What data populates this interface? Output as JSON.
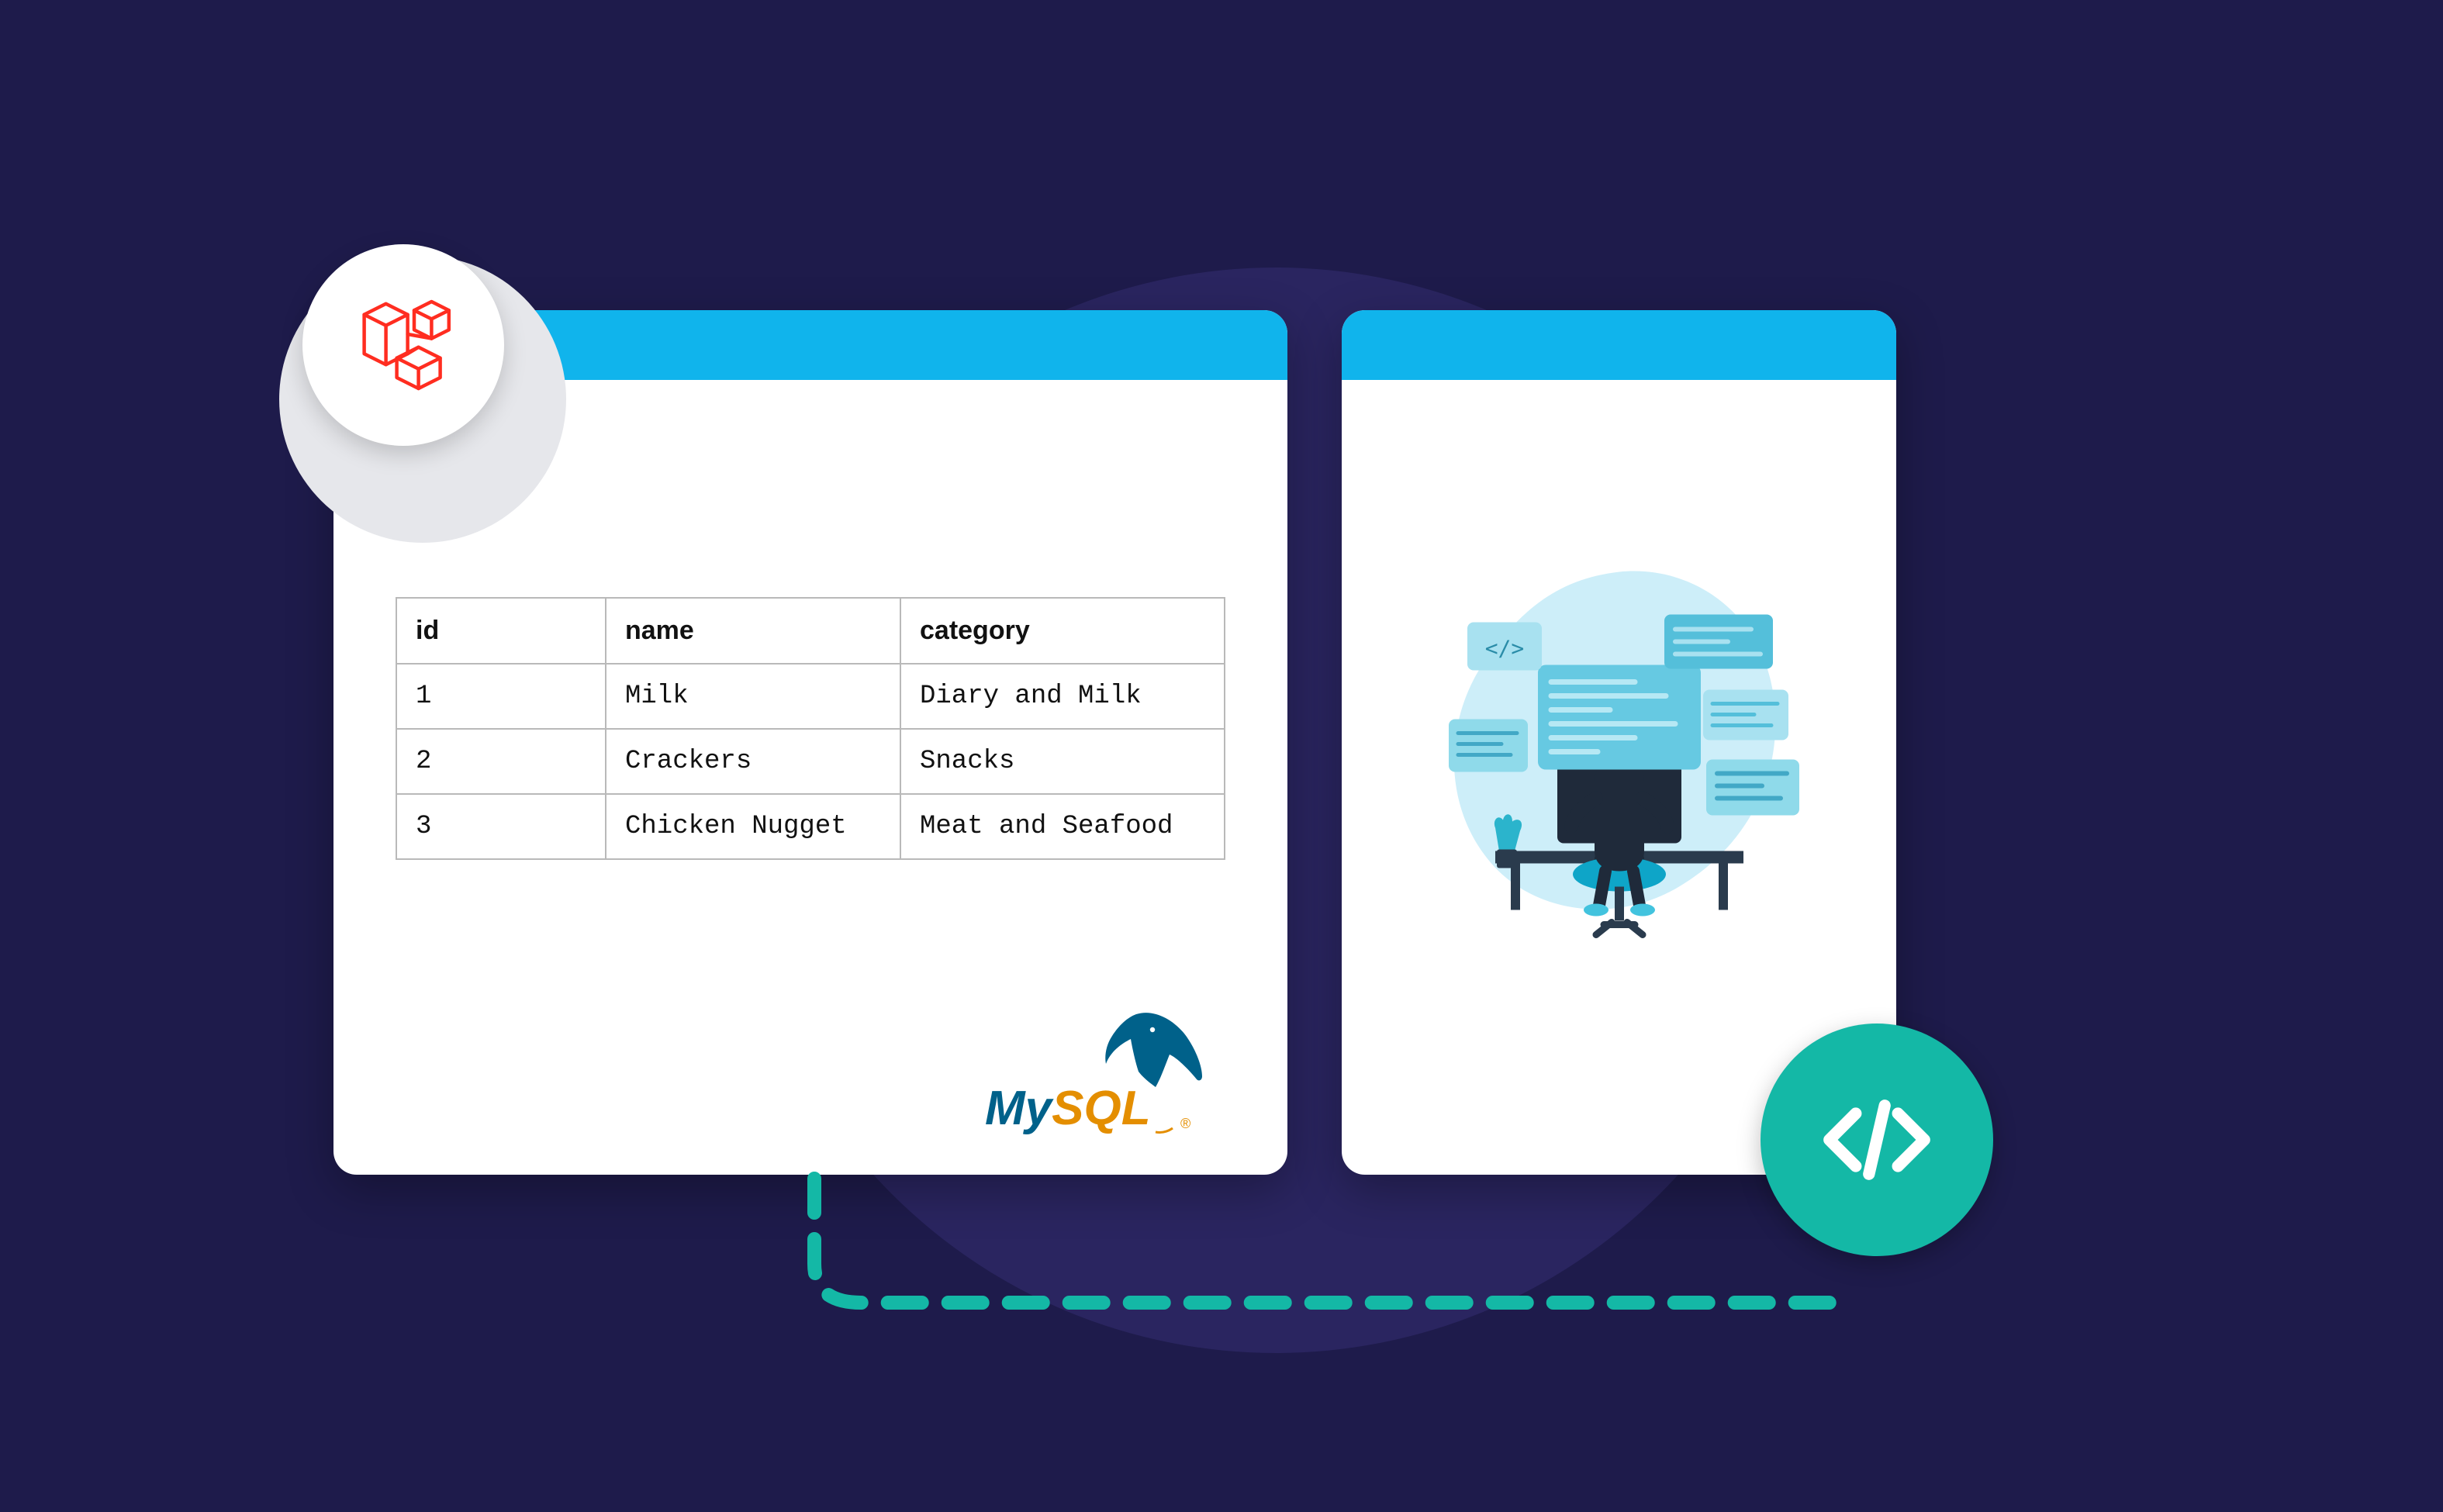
{
  "table": {
    "headers": [
      "id",
      "name",
      "category"
    ],
    "rows": [
      {
        "id": "1",
        "name": "Milk",
        "category": "Diary and Milk"
      },
      {
        "id": "2",
        "name": "Crackers",
        "category": "Snacks"
      },
      {
        "id": "3",
        "name": "Chicken Nugget",
        "category": "Meat and Seafood"
      }
    ]
  },
  "logos": {
    "left_badge": "laravel",
    "db_logo": "MySQL",
    "right_badge": "code"
  },
  "colors": {
    "background": "#1e1b4b",
    "accent_blue": "#10b4ec",
    "teal": "#14b8a6",
    "laravel_red": "#ff2d20",
    "mysql_blue": "#00618a",
    "mysql_orange": "#e48e00"
  }
}
